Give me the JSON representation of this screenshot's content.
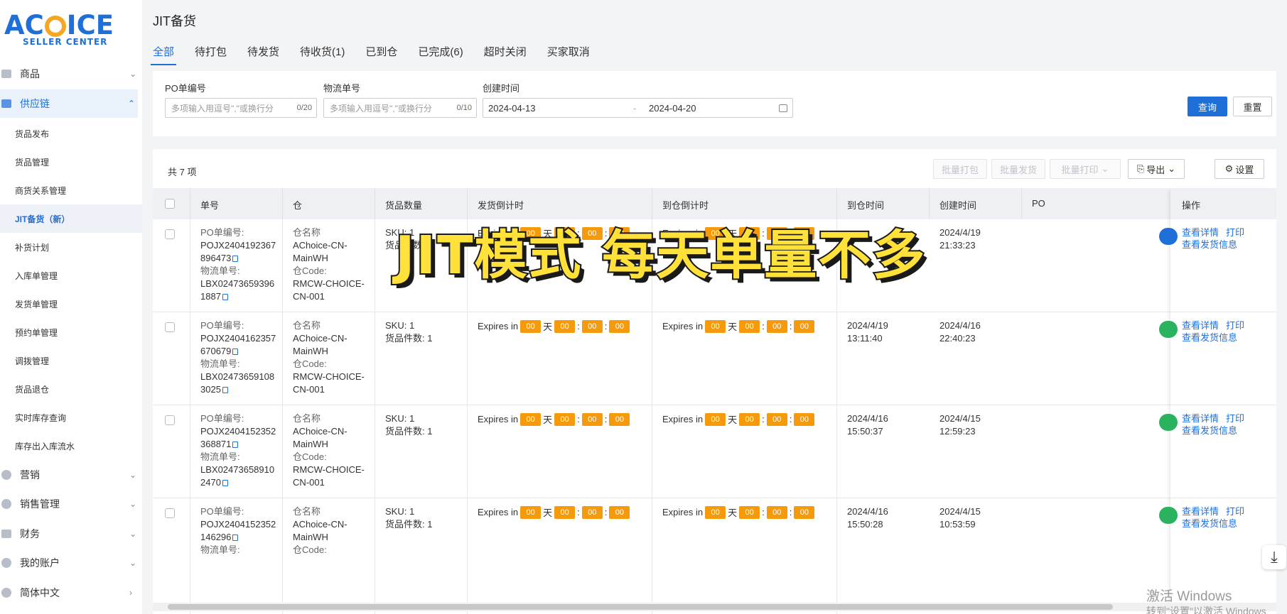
{
  "brand": {
    "logo_text": "ACHOICE",
    "logo_sub": "SELLER CENTER"
  },
  "sidebar": {
    "groups": [
      {
        "label": "商品",
        "icon": "box-icon"
      },
      {
        "label": "供应链",
        "icon": "warehouse-icon"
      },
      {
        "label": "营销",
        "icon": "marketing-icon"
      },
      {
        "label": "销售管理",
        "icon": "sales-icon"
      },
      {
        "label": "财务",
        "icon": "finance-icon"
      },
      {
        "label": "我的账户",
        "icon": "user-icon"
      },
      {
        "label": "简体中文",
        "icon": "globe-icon"
      }
    ],
    "sub_items": [
      "货品发布",
      "货品管理",
      "商货关系管理",
      "JIT备货（新）",
      "补货计划",
      "入库单管理",
      "发货单管理",
      "预约单管理",
      "调拨管理",
      "货品退仓",
      "实时库存查询",
      "库存出入库流水"
    ],
    "active_sub": "JIT备货（新）"
  },
  "page": {
    "title": "JIT备货"
  },
  "tabs": [
    "全部",
    "待打包",
    "待发货",
    "待收货(1)",
    "已到仓",
    "已完成(6)",
    "超时关闭",
    "买家取消"
  ],
  "filters": {
    "po_label": "PO单编号",
    "po_placeholder": "多项输入用逗号\",\"或换行分",
    "po_count": "0/20",
    "logistics_label": "物流单号",
    "logistics_placeholder": "多项输入用逗号\",\"或换行分",
    "logistics_count": "0/10",
    "created_label": "创建时间",
    "date_from": "2024-04-13",
    "date_sep": "-",
    "date_to": "2024-04-20",
    "search_btn": "查询",
    "reset_btn": "重置"
  },
  "table": {
    "total": "共 7 项",
    "toolbar": {
      "batch_pack": "批量打包",
      "batch_ship": "批量发货",
      "batch_print": "批量打印",
      "export": "导出",
      "settings": "设置"
    },
    "headers": {
      "order_no": "单号",
      "warehouse": "仓",
      "goods_qty": "货品数量",
      "ship_countdown": "发货倒计时",
      "arrive_countdown": "到仓倒计时",
      "arrive_time": "到仓时间",
      "created_time": "创建时间",
      "po": "PO",
      "ops": "操作"
    },
    "labels": {
      "po_no": "PO单编号:",
      "logistics_no": "物流单号:",
      "wh_name": "仓名称",
      "wh_code": "仓Code:",
      "sku": "SKU: 1",
      "pieces": "货品件数: 1",
      "expires": "Expires in",
      "days": "天",
      "zero": "00",
      "colon": ":"
    },
    "rows": [
      {
        "po_a": "POJX2404192367",
        "po_b": "896473",
        "lg_a": "LBX02473659396",
        "lg_b": "1887",
        "wh_a": "AChoice-CN-",
        "wh_b": "MainWH",
        "code_a": "RMCW-CHOICE-",
        "code_b": "CN-001",
        "arrive_d": "",
        "arrive_t": "",
        "created_d": "2024/4/19",
        "created_t": "21:33:23",
        "status_color": "#1f6fd8",
        "view_detail": "查看详情",
        "print": "打印",
        "view_ship": "查看发货信息"
      },
      {
        "po_a": "POJX2404162357",
        "po_b": "670679",
        "lg_a": "LBX02473659108",
        "lg_b": "3025",
        "wh_a": "AChoice-CN-",
        "wh_b": "MainWH",
        "code_a": "RMCW-CHOICE-",
        "code_b": "CN-001",
        "arrive_d": "2024/4/19",
        "arrive_t": "13:11:40",
        "created_d": "2024/4/16",
        "created_t": "22:40:23",
        "status_color": "#2bb25e",
        "view_detail": "查看详情",
        "print": "打印",
        "view_ship": "查看发货信息"
      },
      {
        "po_a": "POJX2404152352",
        "po_b": "368871",
        "lg_a": "LBX02473658910",
        "lg_b": "2470",
        "wh_a": "AChoice-CN-",
        "wh_b": "MainWH",
        "code_a": "RMCW-CHOICE-",
        "code_b": "CN-001",
        "arrive_d": "2024/4/16",
        "arrive_t": "15:50:37",
        "created_d": "2024/4/15",
        "created_t": "12:59:23",
        "status_color": "#2bb25e",
        "view_detail": "查看详情",
        "print": "打印",
        "view_ship": "查看发货信息"
      },
      {
        "po_a": "POJX2404152352",
        "po_b": "146296",
        "lg_a": "",
        "lg_b": "",
        "wh_a": "AChoice-CN-",
        "wh_b": "MainWH",
        "code_a": "",
        "code_b": "",
        "arrive_d": "2024/4/16",
        "arrive_t": "15:50:28",
        "created_d": "2024/4/15",
        "created_t": "10:53:59",
        "status_color": "#2bb25e",
        "view_detail": "查看详情",
        "print": "打印",
        "view_ship": "查看发货信息"
      }
    ]
  },
  "overlay": {
    "caption": "JIT模式 每天单量不多"
  },
  "windows": {
    "line1": "激活 Windows",
    "line2": "转到\"设置\"以激活 Windows"
  }
}
